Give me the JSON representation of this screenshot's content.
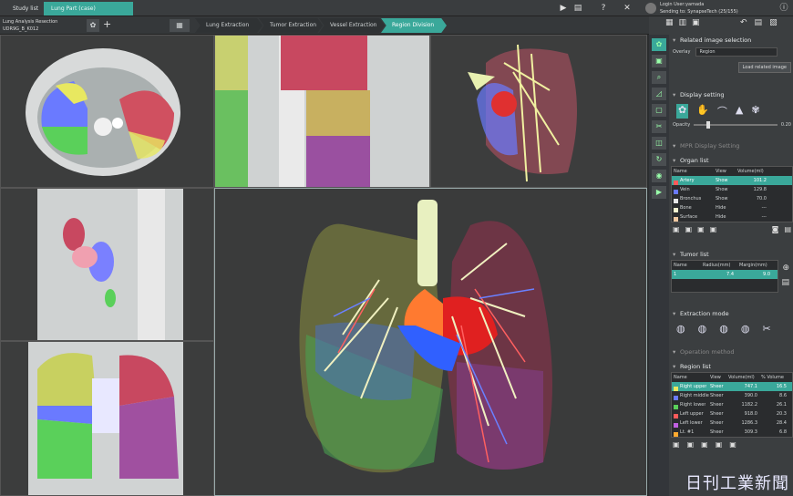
{
  "top_tabs": {
    "study": "Study list",
    "case": "Lung Part (case)"
  },
  "login": {
    "line1": "Login User:yamada",
    "line2": "Sending to: SynapseTech (25/155)"
  },
  "case": {
    "title": "Lung Analysis Resection",
    "id": "UDR9G_B_K012"
  },
  "steps": [
    "Lung Extraction",
    "Tumor Extraction",
    "Vessel Extraction",
    "Region Division"
  ],
  "active_step": 3,
  "panels": {
    "related": "Related image selection",
    "overlay_label": "Overlay",
    "overlay_value": "Region",
    "load_btn": "Load related image",
    "display": "Display setting",
    "opacity_label": "Opacity",
    "opacity_value": "0.20",
    "mpr": "MPR Display Setting",
    "organ": "Organ list",
    "tumor": "Tumor list",
    "extraction": "Extraction mode",
    "operation": "Operation method",
    "region": "Region list"
  },
  "organ_headers": [
    "Name",
    "View",
    "Volume(ml)"
  ],
  "organ_rows": [
    {
      "name": "Artery",
      "view": "Show",
      "vol": "101.2",
      "color": "#ff5a5a"
    },
    {
      "name": "Vein",
      "view": "Show",
      "vol": "129.8",
      "color": "#6a7aff"
    },
    {
      "name": "Bronchus",
      "view": "Show",
      "vol": "70.0",
      "color": "#e8e8e8"
    },
    {
      "name": "Bone",
      "view": "Hide",
      "vol": "---",
      "color": "#f4f4d0"
    },
    {
      "name": "Surface",
      "view": "Hide",
      "vol": "---",
      "color": "#f0c8a0"
    }
  ],
  "tumor_headers": [
    "Name",
    "Radius(mm)",
    "Margin(mm)"
  ],
  "tumor_rows": [
    {
      "name": "1",
      "radius": "7.4",
      "margin": "9.0"
    }
  ],
  "region_headers": [
    "Name",
    "View",
    "Volume(ml)",
    "% Volume"
  ],
  "region_rows": [
    {
      "name": "Right upper",
      "view": "Sheer",
      "vol": "747.1",
      "pct": "16.5",
      "color": "#e8e860"
    },
    {
      "name": "Right middle",
      "view": "Sheer",
      "vol": "390.0",
      "pct": "8.6",
      "color": "#6a7aff"
    },
    {
      "name": "Right lower",
      "view": "Sheer",
      "vol": "1182.2",
      "pct": "26.1",
      "color": "#5ad05a"
    },
    {
      "name": "Left upper",
      "view": "Sheer",
      "vol": "918.0",
      "pct": "20.3",
      "color": "#ff5a5a"
    },
    {
      "name": "Left lower",
      "view": "Sheer",
      "vol": "1286.3",
      "pct": "28.4",
      "color": "#c060e0"
    },
    {
      "name": "Lt. #1",
      "view": "Sheer",
      "vol": "309.3",
      "pct": "6.8",
      "color": "#ffaa30"
    }
  ],
  "watermark": "日刊工業新聞"
}
